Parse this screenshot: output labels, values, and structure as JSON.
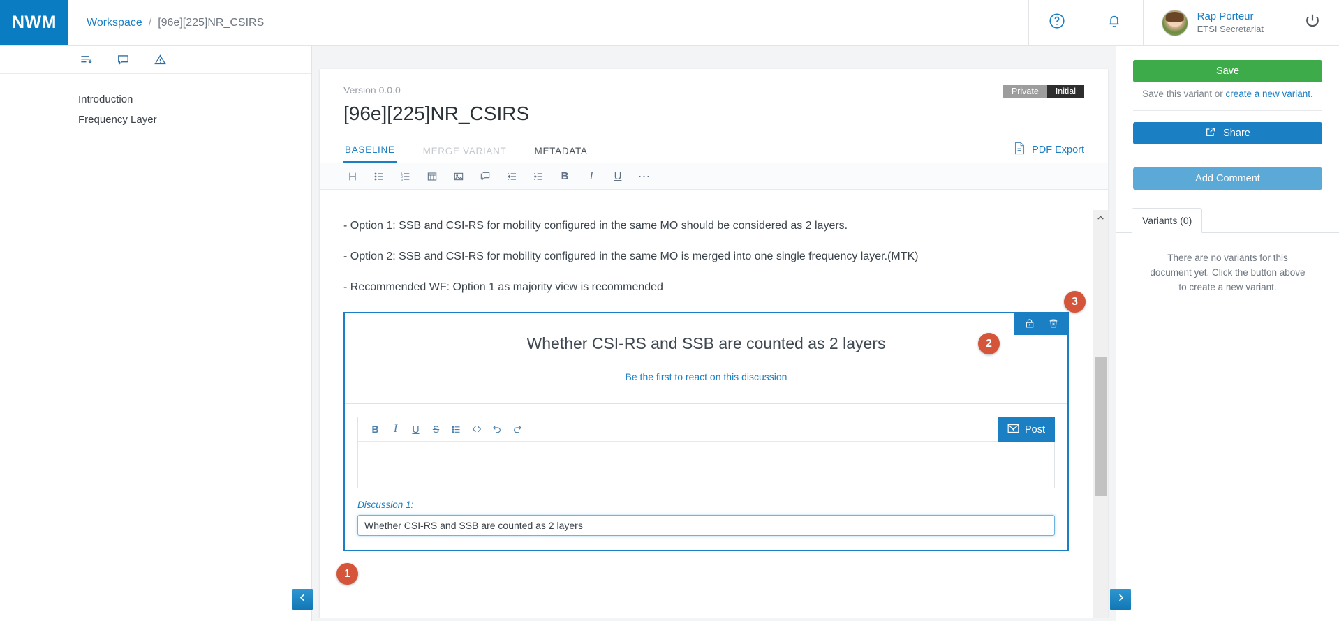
{
  "app": {
    "logo": "NWM",
    "brand_color": "#0a7cc1"
  },
  "breadcrumb": {
    "root": "Workspace",
    "separator": "/",
    "current": "[96e][225]NR_CSIRS"
  },
  "topbar": {
    "help_icon": "help-circle-icon",
    "notifications_icon": "bell-icon",
    "power_icon": "power-icon",
    "user": {
      "name": "Rap Porteur",
      "role": "ETSI Secretariat"
    }
  },
  "left_nav": {
    "tools": [
      "outline-icon",
      "comment-icon",
      "warning-icon"
    ],
    "items": [
      {
        "label": "Introduction"
      },
      {
        "label": "Frequency Layer"
      }
    ]
  },
  "document": {
    "version": "Version 0.0.0",
    "title": "[96e][225]NR_CSIRS",
    "badges": {
      "visibility": "Private",
      "state": "Initial"
    },
    "tabs": [
      {
        "label": "BASELINE",
        "state": "active"
      },
      {
        "label": "MERGE VARIANT",
        "state": "disabled"
      },
      {
        "label": "METADATA",
        "state": "normal"
      }
    ],
    "pdf_export": "PDF Export"
  },
  "editor_toolbar": {
    "buttons": [
      "heading-icon",
      "bullet-list-icon",
      "numbered-list-icon",
      "table-icon",
      "image-icon",
      "comment-bubble-icon",
      "outdent-icon",
      "indent-icon",
      "bold-icon",
      "italic-icon",
      "underline-icon",
      "more-icon"
    ]
  },
  "content": {
    "paragraphs": [
      "- Option 1: SSB and CSI-RS for mobility configured in the same MO should be considered as 2 layers.",
      "- Option 2: SSB and CSI-RS for mobility configured in the same MO is merged into one single frequency layer.(MTK)",
      "- Recommended WF: Option 1 as majority view is recommended"
    ]
  },
  "discussion": {
    "title": "Whether CSI-RS and SSB are counted as 2 layers",
    "react_link": "Be the first to react on this discussion",
    "actions": [
      "lock-icon",
      "trash-icon"
    ],
    "comment_toolbar": [
      "bold-icon",
      "italic-icon",
      "underline-icon",
      "strikethrough-icon",
      "bullet-list-icon",
      "code-icon",
      "undo-icon",
      "redo-icon"
    ],
    "post_label": "Post",
    "post_icon": "send-mail-icon",
    "input_label": "Discussion 1:",
    "input_value": "Whether CSI-RS and SSB are counted as 2 layers",
    "input_placeholder": ""
  },
  "markers": [
    {
      "number": "1"
    },
    {
      "number": "2"
    },
    {
      "number": "3"
    }
  ],
  "sidebar": {
    "save_label": "Save",
    "hint_prefix": "Save this variant or ",
    "hint_link": "create a new variant.",
    "share_label": "Share",
    "share_icon": "external-link-icon",
    "add_comment_label": "Add Comment",
    "variants_tab": "Variants (0)",
    "variants_empty": "There are no variants for this document yet. Click the button above to create a new variant."
  },
  "nav": {
    "prev_icon": "chevron-left-icon",
    "next_icon": "chevron-right-icon"
  },
  "scroll": {
    "up_icon": "chevron-up-icon"
  }
}
